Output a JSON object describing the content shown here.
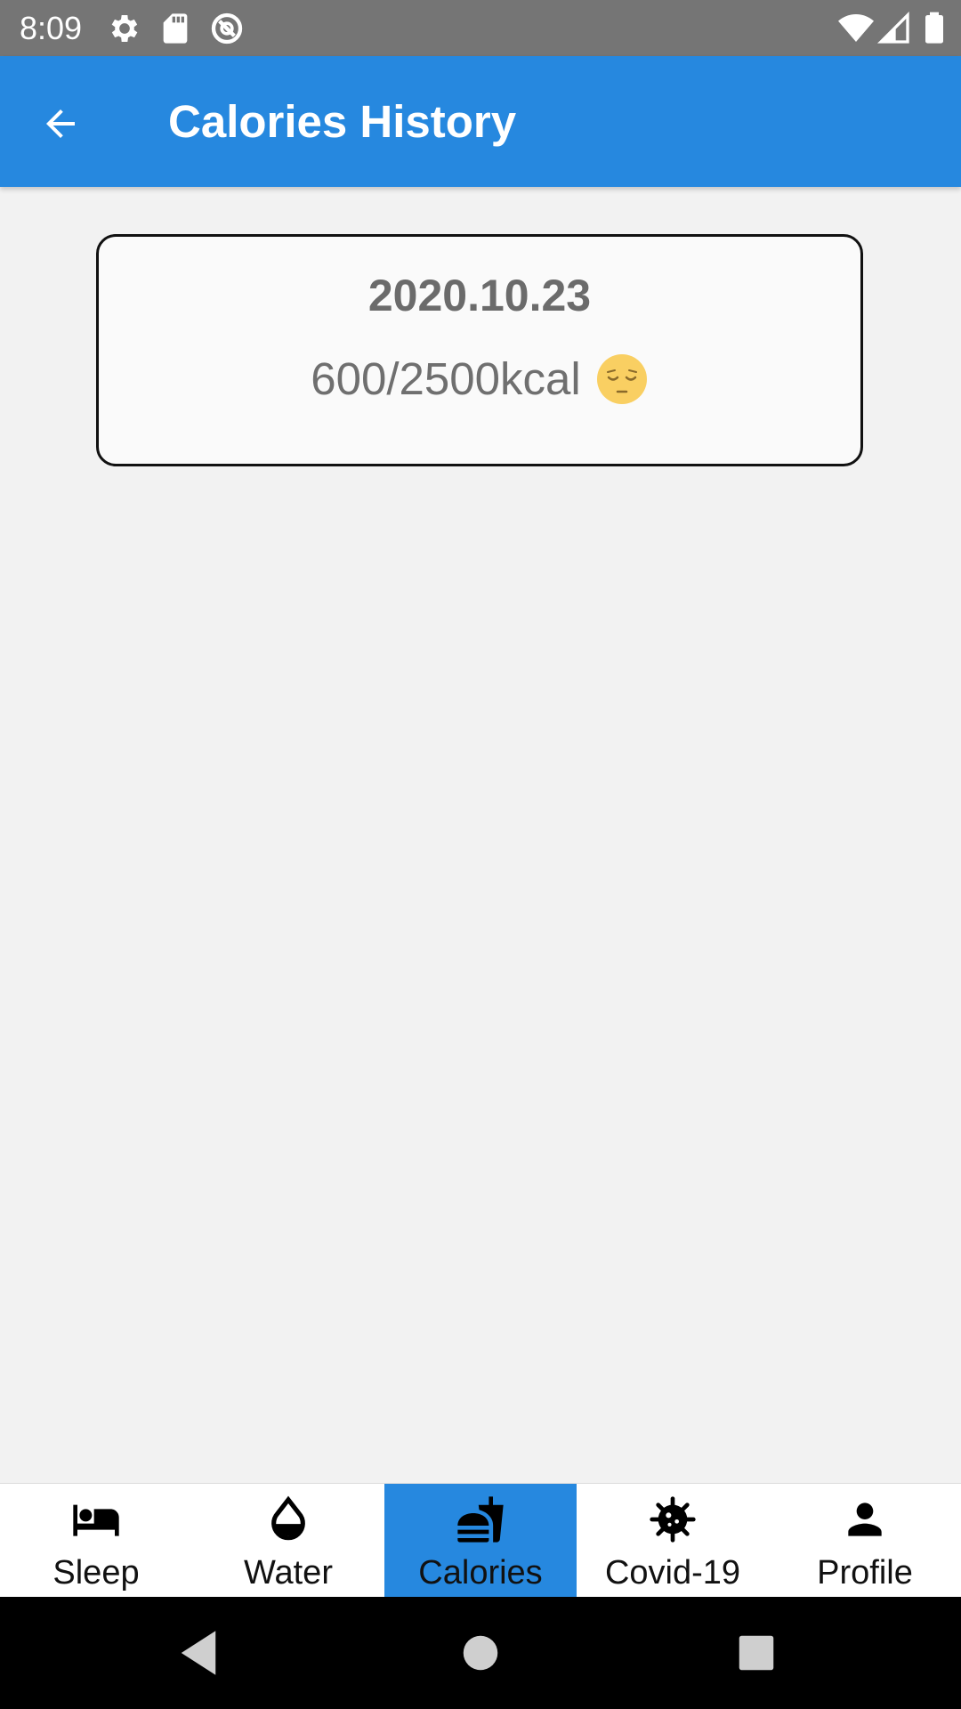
{
  "status_bar": {
    "time": "8:09",
    "icons": [
      "settings-gear-icon",
      "sd-card-icon",
      "data-saver-icon",
      "wifi-icon",
      "cell-signal-icon",
      "battery-icon"
    ]
  },
  "app_bar": {
    "title": "Calories History",
    "back_icon": "arrow-back-icon"
  },
  "history": {
    "entries": [
      {
        "date": "2020.10.23",
        "kcal": "600/2500kcal",
        "mood_icon": "pensive-face-emoji"
      }
    ]
  },
  "bottom_nav": {
    "items": [
      {
        "label": "Sleep",
        "icon": "bed-icon",
        "active": false
      },
      {
        "label": "Water",
        "icon": "water-drop-icon",
        "active": false
      },
      {
        "label": "Calories",
        "icon": "fastfood-icon",
        "active": true
      },
      {
        "label": "Covid-19",
        "icon": "virus-icon",
        "active": false
      },
      {
        "label": "Profile",
        "icon": "person-icon",
        "active": false
      }
    ]
  },
  "colors": {
    "primary": "#2688df",
    "status_bar": "#757575",
    "background": "#f2f2f2"
  }
}
